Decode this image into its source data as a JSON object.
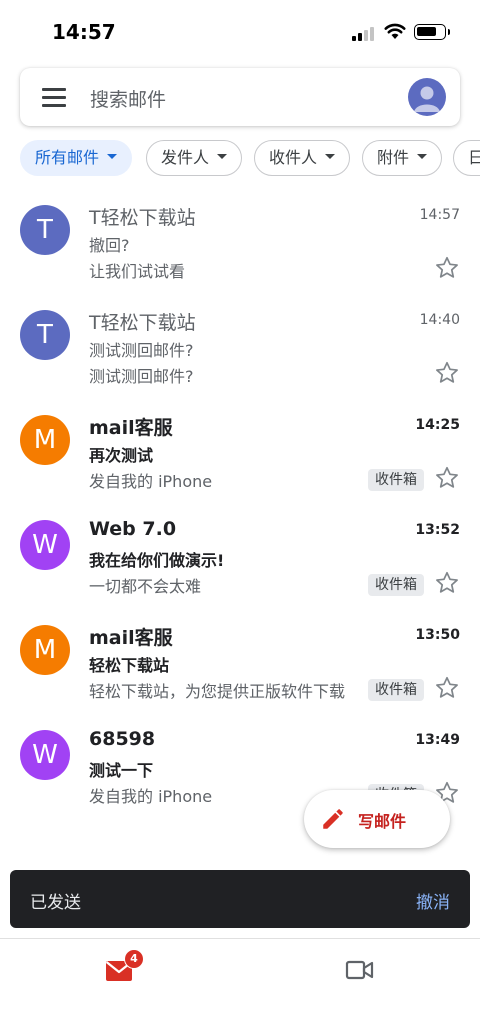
{
  "status_bar": {
    "time": "14:57"
  },
  "search": {
    "placeholder": "搜索邮件"
  },
  "filters": [
    {
      "label": "所有邮件",
      "active": true
    },
    {
      "label": "发件人",
      "active": false
    },
    {
      "label": "收件人",
      "active": false
    },
    {
      "label": "附件",
      "active": false
    },
    {
      "label": "日",
      "active": false
    }
  ],
  "emails": [
    {
      "avatar_letter": "T",
      "avatar_color": "#5c6bc0",
      "sender": "T轻松下载站",
      "time": "14:57",
      "subject": "撤回?",
      "snippet": "让我们试试看",
      "label": "",
      "unread": false
    },
    {
      "avatar_letter": "T",
      "avatar_color": "#5c6bc0",
      "sender": "T轻松下载站",
      "time": "14:40",
      "subject": "测试测回邮件?",
      "snippet": "测试测回邮件?",
      "label": "",
      "unread": false
    },
    {
      "avatar_letter": "M",
      "avatar_color": "#f57c00",
      "sender": "mail客服",
      "time": "14:25",
      "subject": "再次测试",
      "snippet": "发自我的 iPhone",
      "label": "收件箱",
      "unread": true
    },
    {
      "avatar_letter": "W",
      "avatar_color": "#a142f4",
      "sender": "Web 7.0",
      "time": "13:52",
      "subject": "我在给你们做演示!",
      "snippet": "一切都不会太难",
      "label": "收件箱",
      "unread": true
    },
    {
      "avatar_letter": "M",
      "avatar_color": "#f57c00",
      "sender": "mail客服",
      "time": "13:50",
      "subject": "轻松下载站",
      "snippet": "轻松下载站，为您提供正版软件下载",
      "label": "收件箱",
      "unread": true
    },
    {
      "avatar_letter": "W",
      "avatar_color": "#a142f4",
      "sender": "68598",
      "time": "13:49",
      "subject": "测试一下",
      "snippet": "发自我的 iPhone",
      "label": "收件箱",
      "unread": true
    }
  ],
  "compose": {
    "label": "写邮件"
  },
  "snackbar": {
    "message": "已发送",
    "action": "撤消"
  },
  "bottom_nav": {
    "mail_badge": "4",
    "tabs": [
      "mail-icon",
      "video-icon"
    ]
  },
  "colors": {
    "accent": "#1967d2",
    "compose": "#c5221f",
    "badge": "#d93025"
  }
}
